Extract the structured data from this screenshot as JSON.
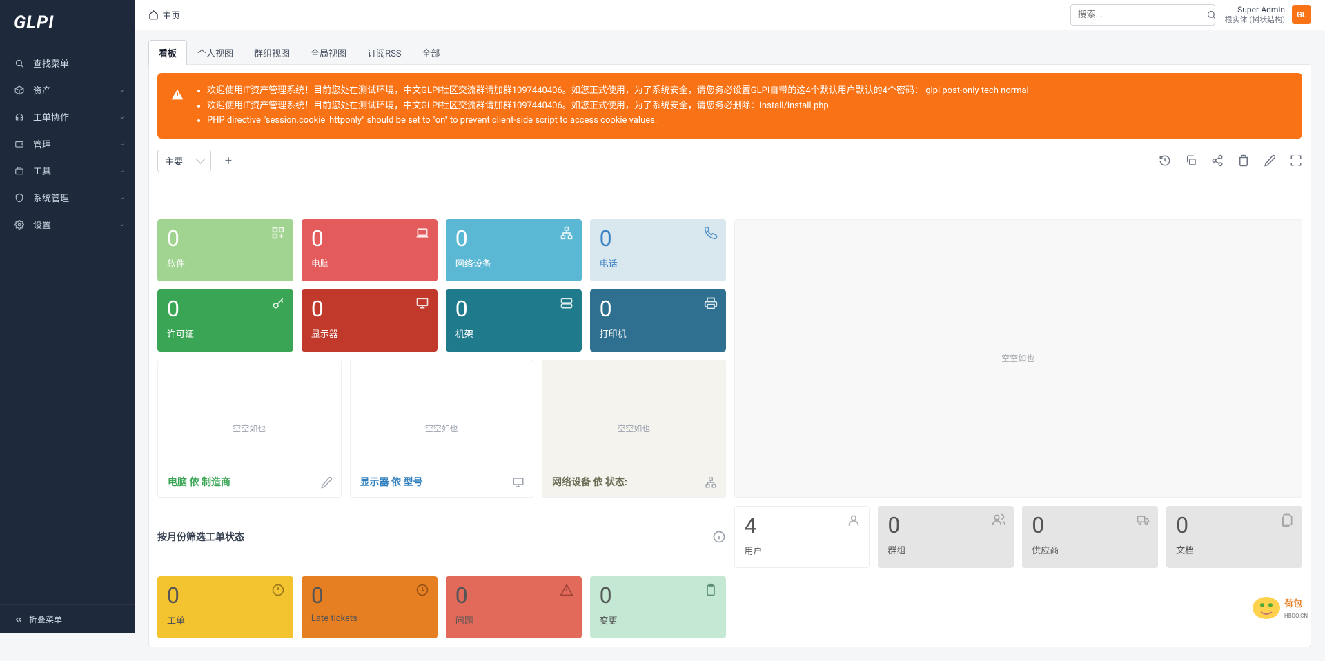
{
  "logo": "GLPI",
  "breadcrumb": "主页",
  "search": {
    "placeholder": "搜索...",
    "value": ""
  },
  "user": {
    "name": "Super-Admin",
    "entity": "根实体 (树状结构)",
    "initials": "GL"
  },
  "sidebar": {
    "items": [
      {
        "label": "查找菜单"
      },
      {
        "label": "资产"
      },
      {
        "label": "工单协作"
      },
      {
        "label": "管理"
      },
      {
        "label": "工具"
      },
      {
        "label": "系统管理"
      },
      {
        "label": "设置"
      }
    ],
    "collapse": "折叠菜单"
  },
  "tabs": [
    "看板",
    "个人视图",
    "群组视图",
    "全局视图",
    "订阅RSS",
    "全部"
  ],
  "alerts": [
    "欢迎使用IT资产管理系统！目前您处在测试环境，中文GLPI社区交流群请加群1097440406。如您正式使用，为了系统安全，请您务必设置GLPI自带的这4个默认用户默认的4个密码：  glpi post-only tech normal",
    "欢迎使用IT资产管理系统！目前您处在测试环境，中文GLPI社区交流群请加群1097440406。如您正式使用，为了系统安全，请您务必删除：install/install.php",
    "PHP directive \"session.cookie_httponly\" should be set to \"on\" to prevent client-side script to access cookie values."
  ],
  "dashboard_selector": "主要",
  "cards_row1": [
    {
      "num": "0",
      "lbl": "软件",
      "bg": "#a1d490"
    },
    {
      "num": "0",
      "lbl": "电脑",
      "bg": "#e45b5b"
    },
    {
      "num": "0",
      "lbl": "网络设备",
      "bg": "#5bb8d4"
    },
    {
      "num": "0",
      "lbl": "电话",
      "bg": "#d9e8ef",
      "fg": "#3b82c4"
    }
  ],
  "cards_row2": [
    {
      "num": "0",
      "lbl": "许可证",
      "bg": "#3aa655"
    },
    {
      "num": "0",
      "lbl": "显示器",
      "bg": "#c0392b"
    },
    {
      "num": "0",
      "lbl": "机架",
      "bg": "#1f7a8c"
    },
    {
      "num": "0",
      "lbl": "打印机",
      "bg": "#2f6f8f"
    }
  ],
  "large_cards": [
    {
      "title": "电脑 依 制造商",
      "title_color": "#3aa655"
    },
    {
      "title": "显示器 依 型号",
      "title_color": "#2f7fbf"
    },
    {
      "title": "网络设备 依 状态:",
      "title_color": "#6b6b55"
    }
  ],
  "empty_text": "空空如也",
  "bottom_cards": [
    {
      "num": "4",
      "lbl": "用户",
      "bg": "#ffffff",
      "fg": "#555"
    },
    {
      "num": "0",
      "lbl": "群组",
      "bg": "#e5e5e5",
      "fg": "#555"
    },
    {
      "num": "0",
      "lbl": "供应商",
      "bg": "#e5e5e5",
      "fg": "#555"
    },
    {
      "num": "0",
      "lbl": "文档",
      "bg": "#e5e5e5",
      "fg": "#555"
    }
  ],
  "ticket_section_title": "按月份筛选工单状态",
  "ticket_cards": [
    {
      "num": "0",
      "lbl": "工单",
      "bg": "#f4c430",
      "fg": "#555"
    },
    {
      "num": "0",
      "lbl": "Late tickets",
      "bg": "#e67e22",
      "fg": "#555"
    },
    {
      "num": "0",
      "lbl": "问题",
      "bg": "#e26a5a",
      "fg": "#555"
    },
    {
      "num": "0",
      "lbl": "变更",
      "bg": "#c4e8d4",
      "fg": "#555"
    }
  ]
}
